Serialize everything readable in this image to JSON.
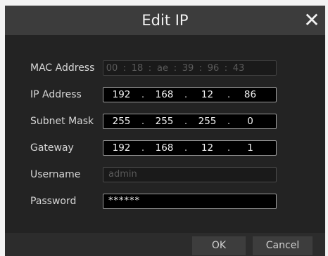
{
  "dialog": {
    "title": "Edit IP",
    "close_icon": "close-icon",
    "ok_label": "OK",
    "cancel_label": "Cancel"
  },
  "fields": {
    "mac": {
      "label": "MAC Address",
      "octets": [
        "00",
        "18",
        "ae",
        "39",
        "96",
        "43"
      ],
      "separator": ":"
    },
    "ip": {
      "label": "IP Address",
      "octets": [
        "192",
        "168",
        "12",
        "86"
      ],
      "separator": "."
    },
    "subnet": {
      "label": "Subnet Mask",
      "octets": [
        "255",
        "255",
        "255",
        "0"
      ],
      "separator": "."
    },
    "gateway": {
      "label": "Gateway",
      "octets": [
        "192",
        "168",
        "12",
        "1"
      ],
      "separator": "."
    },
    "username": {
      "label": "Username",
      "placeholder": "admin"
    },
    "password": {
      "label": "Password",
      "value": "******"
    }
  },
  "colors": {
    "titlebar": "#3c3c3c",
    "body": "#232323",
    "field_border": "#9a9a9a",
    "button": "#3d3d3d"
  }
}
